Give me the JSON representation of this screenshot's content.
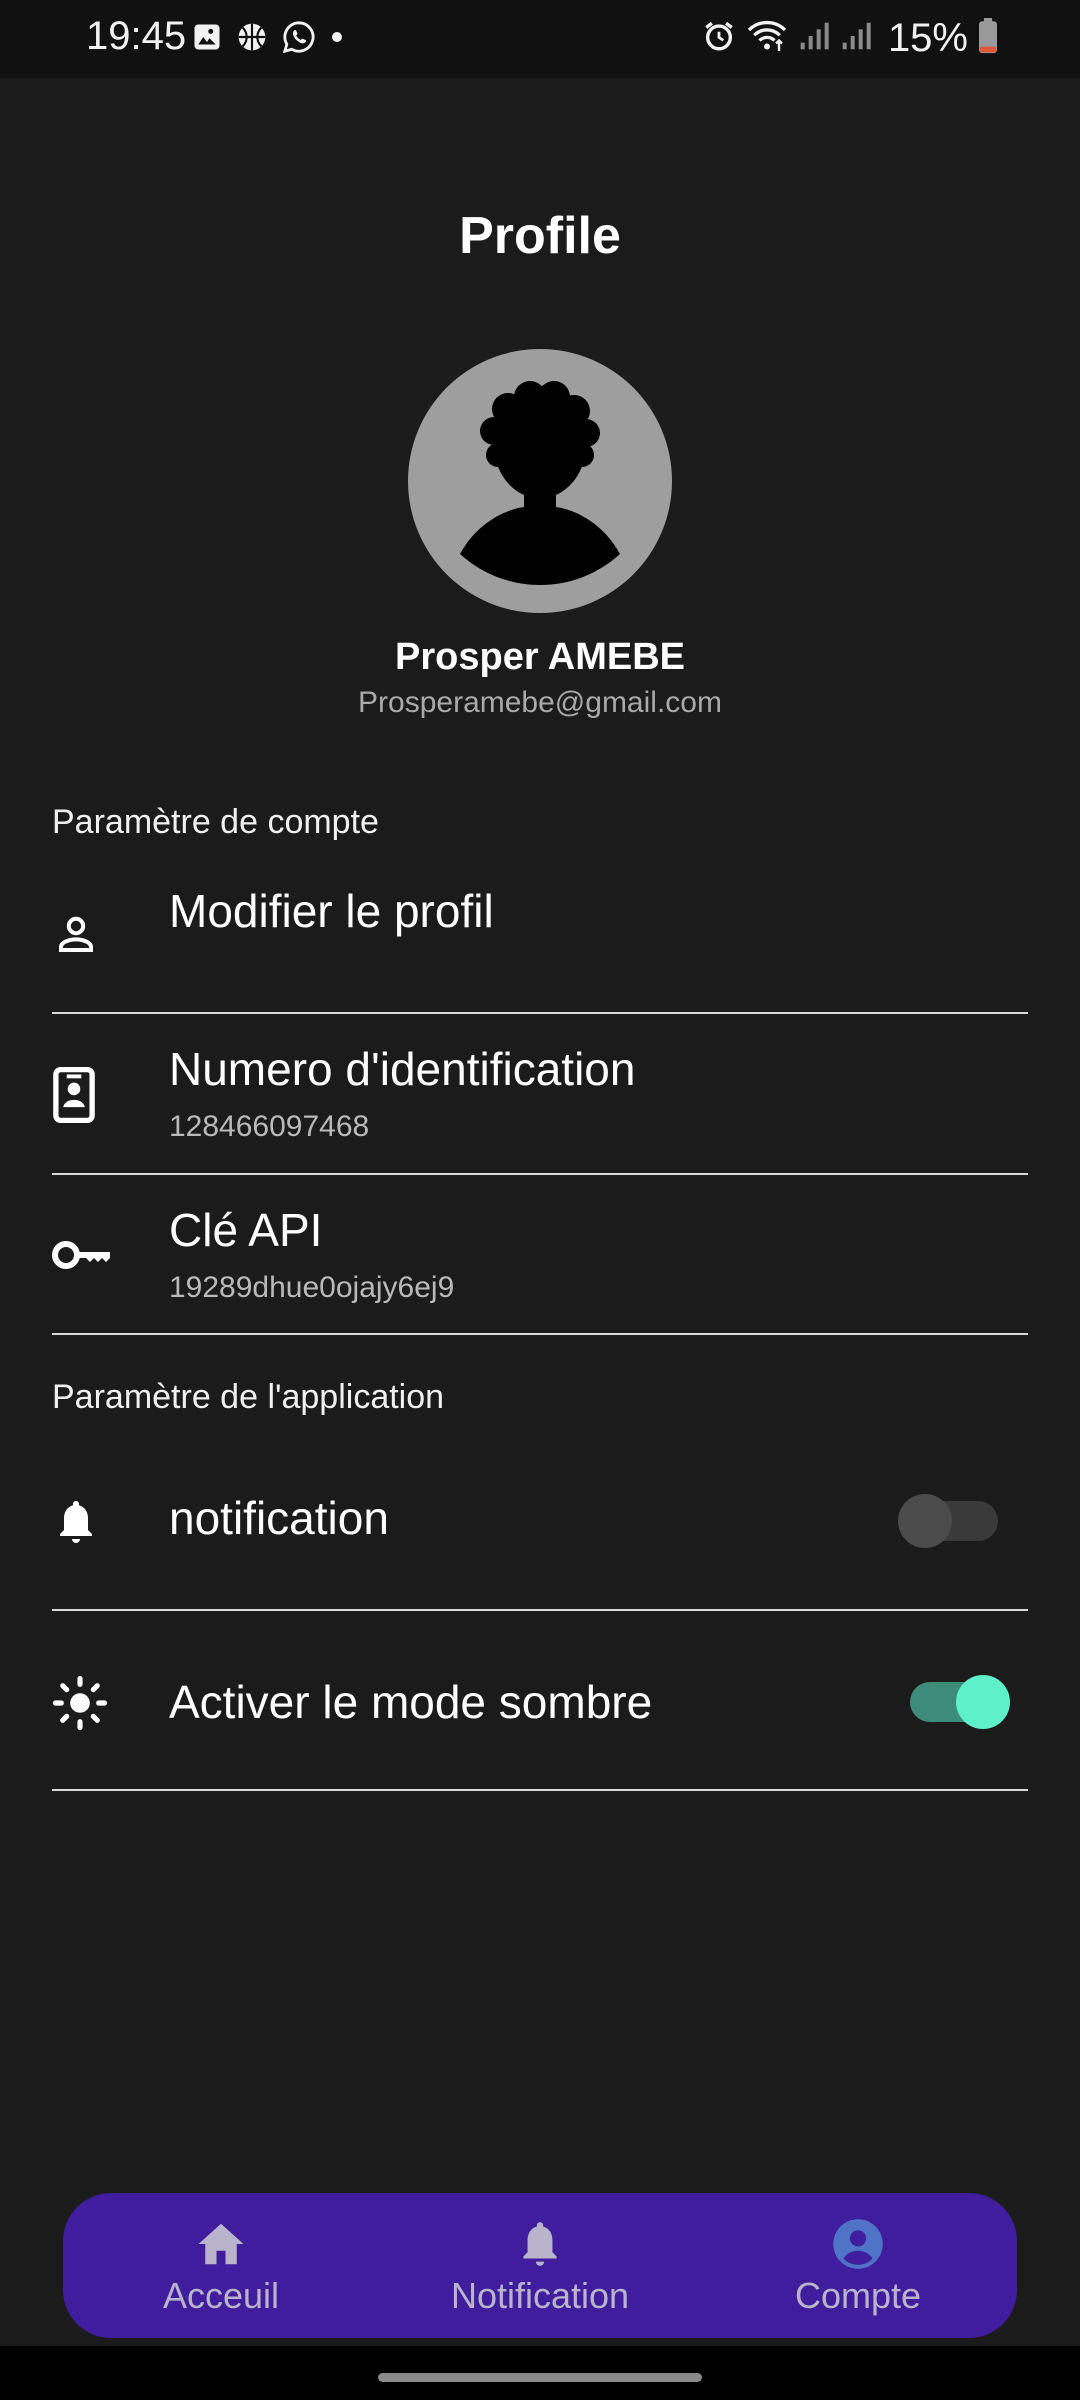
{
  "status_bar": {
    "time": "19:45",
    "battery": "15%",
    "left_icons": [
      "gallery-icon",
      "basketball-icon",
      "whatsapp-icon",
      "dot-icon"
    ],
    "right_icons": [
      "alarm-icon",
      "wifi-icon",
      "signal-icon",
      "signal-icon",
      "battery-icon"
    ]
  },
  "page": {
    "title": "Profile"
  },
  "user": {
    "name": "Prosper AMEBE",
    "email": "Prosperamebe@gmail.com"
  },
  "account_section": {
    "label": "Paramètre de compte",
    "items": [
      {
        "icon": "person-outline-icon",
        "title": "Modifier le profil",
        "subtitle": ""
      },
      {
        "icon": "id-badge-icon",
        "title": "Numero d'identification",
        "subtitle": "128466097468"
      },
      {
        "icon": "key-icon",
        "title": "Clé API",
        "subtitle": "19289dhue0ojajy6ej9"
      }
    ]
  },
  "app_section": {
    "label": "Paramètre de l'application",
    "items": [
      {
        "icon": "bell-icon",
        "title": "notification",
        "toggle": false
      },
      {
        "icon": "sun-icon",
        "title": "Activer le mode sombre",
        "toggle": true
      }
    ]
  },
  "bottom_nav": {
    "items": [
      {
        "icon": "home-icon",
        "label": "Acceuil",
        "active": false
      },
      {
        "icon": "bell-icon",
        "label": "Notification",
        "active": false
      },
      {
        "icon": "account-circle-icon",
        "label": "Compte",
        "active": true
      }
    ]
  },
  "colors": {
    "background": "#1b1b1c",
    "nav_background": "#3f1d9c",
    "nav_inactive": "#b9b3cc",
    "nav_active": "#4f74c7",
    "toggle_on_track": "#3d8c7a",
    "toggle_on_knob": "#5ef0c8"
  }
}
